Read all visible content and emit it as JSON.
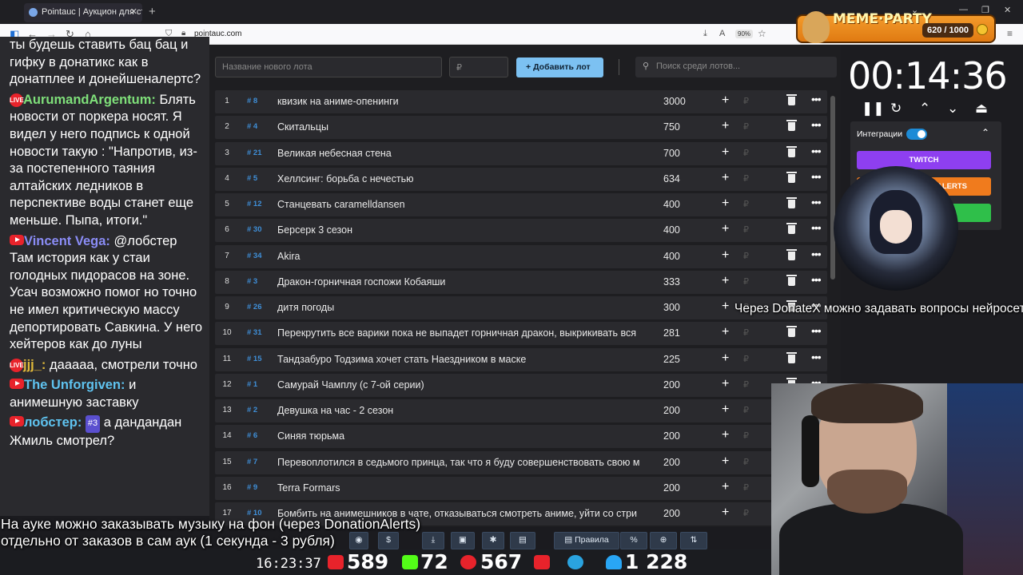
{
  "browser": {
    "tab_title": "Pointauc | Аукцион для стрим",
    "url": "pointauc.com",
    "zoom": "90%"
  },
  "meme_party": {
    "title": "MEME·PARTY",
    "score": "620 / 1000"
  },
  "chat": [
    {
      "user": "",
      "text": "ты будешь ставить бац бац и гифку в донатикс как в донатплее и донейшеналертс?",
      "platform": "",
      "color": ""
    },
    {
      "user": "AurumandArgentum:",
      "text": "Блять новости от поркера носят. Я видел у него подпись к одной новости такую : \"Напротив, из-за постепенного таяния алтайских ледников в перспективе воды станет еще меньше. Пыпа, итоги.\"",
      "platform": "live",
      "color": "#7fe07a"
    },
    {
      "user": "Vincent Vega:",
      "text": "@лобстер Там история как у стаи голодных пидорасов на зоне. Усач возможно помог но точно не имел критическую массу депортировать Савкина. У него хейтеров как до луны",
      "platform": "youtube",
      "color": "#8a8cf5"
    },
    {
      "user": "jjj_:",
      "text": "дааааа, смотрели точно",
      "platform": "live",
      "color": "#e0b93a"
    },
    {
      "user": "The Unforgiven:",
      "text": "и анимешную заставку",
      "platform": "youtube",
      "color": "#5fc3f0"
    },
    {
      "user": "лобстер:",
      "text": "а дандандан Жмиль смотрел?",
      "platform": "youtube",
      "color": "#5fc3f0",
      "badge": "#3"
    }
  ],
  "toolbar": {
    "new_lot_placeholder": "Название нового лота",
    "amount_placeholder": "₽",
    "add_button": "Добавить лот",
    "search_placeholder": "Поиск среди лотов..."
  },
  "lots": [
    {
      "n": "1",
      "id": "# 8",
      "name": "квизик на аниме-опенинги",
      "amount": "3000"
    },
    {
      "n": "2",
      "id": "# 4",
      "name": "Скитальцы",
      "amount": "750"
    },
    {
      "n": "3",
      "id": "# 21",
      "name": "Великая небесная стена",
      "amount": "700"
    },
    {
      "n": "4",
      "id": "# 5",
      "name": "Хеллсинг: борьба с нечестью",
      "amount": "634"
    },
    {
      "n": "5",
      "id": "# 12",
      "name": "Станцевать caramelldansen",
      "amount": "400"
    },
    {
      "n": "6",
      "id": "# 30",
      "name": "Берсерк 3 сезон",
      "amount": "400"
    },
    {
      "n": "7",
      "id": "# 34",
      "name": "Akira",
      "amount": "400"
    },
    {
      "n": "8",
      "id": "# 3",
      "name": "Дракон-горничная госпожи Кобаяши",
      "amount": "333"
    },
    {
      "n": "9",
      "id": "# 26",
      "name": "дитя погоды",
      "amount": "300"
    },
    {
      "n": "10",
      "id": "# 31",
      "name": "Перекрутить все варики пока не выпадет горничная дракон, выкрикивать вся",
      "amount": "281"
    },
    {
      "n": "11",
      "id": "# 15",
      "name": "Тандзабуро Тодзима хочет стать Наездником в маске",
      "amount": "225"
    },
    {
      "n": "12",
      "id": "# 1",
      "name": "Самурай Чамплу (с 7-ой серии)",
      "amount": "200"
    },
    {
      "n": "13",
      "id": "# 2",
      "name": "Девушка на час - 2 сезон",
      "amount": "200"
    },
    {
      "n": "14",
      "id": "# 6",
      "name": "Синяя тюрьма",
      "amount": "200"
    },
    {
      "n": "15",
      "id": "# 7",
      "name": "Перевоплотился в седьмого принца, так что я буду совершенствовать свою м",
      "amount": "200"
    },
    {
      "n": "16",
      "id": "# 9",
      "name": "Terra Formars",
      "amount": "200"
    },
    {
      "n": "17",
      "id": "# 10",
      "name": "Бомбить на анимешников в чате, отказываться смотреть аниме, уйти со стри",
      "amount": "200"
    }
  ],
  "currency": "₽",
  "bottom_tools": {
    "rules": "Правила",
    "percent": "%"
  },
  "timer": "00:14:36",
  "integrations": {
    "label": "Интеграции",
    "twitch": "TWITCH",
    "alerts": "ALERTS"
  },
  "captions": {
    "donatex": "Через DonateX можно задавать вопросы нейросети",
    "music_line1": "На ауке можно заказывать музыку на фон (через DonationAlerts)",
    "music_line2": "отдельно от заказов в сам аук (1 секунда - 3 рубля)"
  },
  "stream": {
    "clock": "16:23:37",
    "youtube_viewers": "589",
    "kick_viewers": "72",
    "live_viewers": "567",
    "followers": "1 228"
  }
}
